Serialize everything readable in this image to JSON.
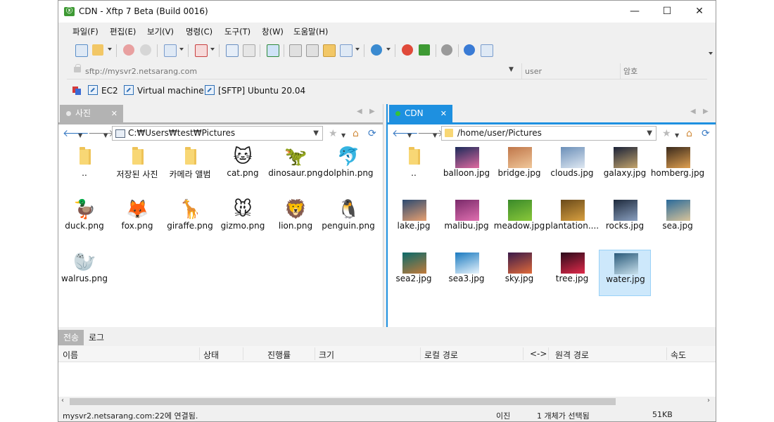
{
  "window": {
    "logo": "Xftp",
    "title": "CDN - Xftp 7 Beta (Build 0016)",
    "controls": {
      "minimize": "—",
      "maximize": "☐",
      "close": "✕"
    }
  },
  "menu": [
    "파일(F)",
    "편집(E)",
    "보기(V)",
    "명령(C)",
    "도구(T)",
    "창(W)",
    "도움말(H)"
  ],
  "address": {
    "placeholder": "sftp://mysvr2.netsarang.com",
    "user_placeholder": "user",
    "password_placeholder": "암호"
  },
  "links": [
    "EC2",
    "Virtual machine",
    "[SFTP] Ubuntu 20.04"
  ],
  "left_pane": {
    "tab": "사진",
    "path": "C:₩Users₩test₩Pictures",
    "files": [
      {
        "name": "..",
        "type": "folder"
      },
      {
        "name": "저장된 사진",
        "type": "folder"
      },
      {
        "name": "카메라 앨범",
        "type": "folder"
      },
      {
        "name": "cat.png",
        "icon": "🐱"
      },
      {
        "name": "dinosaur.png",
        "icon": "🦖"
      },
      {
        "name": "dolphin.png",
        "icon": "🐬"
      },
      {
        "name": "duck.png",
        "icon": "🦆"
      },
      {
        "name": "fox.png",
        "icon": "🦊"
      },
      {
        "name": "giraffe.png",
        "icon": "🦒"
      },
      {
        "name": "gizmo.png",
        "icon": "🐭"
      },
      {
        "name": "lion.png",
        "icon": "🦁"
      },
      {
        "name": "penguin.png",
        "icon": "🐧"
      },
      {
        "name": "walrus.png",
        "icon": "🦭"
      }
    ]
  },
  "right_pane": {
    "tab": "CDN",
    "path": "/home/user/Pictures",
    "files": [
      {
        "name": "..",
        "type": "folder"
      },
      {
        "name": "balloon.jpg",
        "colors": [
          "#1c2b5a",
          "#e06aa0"
        ]
      },
      {
        "name": "bridge.jpg",
        "colors": [
          "#c0774a",
          "#f0c79a"
        ]
      },
      {
        "name": "clouds.jpg",
        "colors": [
          "#6b8fb8",
          "#dfe8f2"
        ]
      },
      {
        "name": "galaxy.jpg",
        "colors": [
          "#1a2238",
          "#c3a46c"
        ]
      },
      {
        "name": "homberg.jpg",
        "colors": [
          "#3a2a1c",
          "#e0a050"
        ]
      },
      {
        "name": "lake.jpg",
        "colors": [
          "#2c4a70",
          "#e8a070"
        ]
      },
      {
        "name": "malibu.jpg",
        "colors": [
          "#7a2a6a",
          "#e070b0"
        ]
      },
      {
        "name": "meadow.jpg",
        "colors": [
          "#3a8a2a",
          "#8ac83a"
        ]
      },
      {
        "name": "plantation....",
        "colors": [
          "#6a4a1a",
          "#d8a040"
        ]
      },
      {
        "name": "rocks.jpg",
        "colors": [
          "#1e2a3c",
          "#8aa0c0"
        ]
      },
      {
        "name": "sea.jpg",
        "colors": [
          "#2a6a9a",
          "#d8c49a"
        ]
      },
      {
        "name": "sea2.jpg",
        "colors": [
          "#0a6a6a",
          "#c07a3a"
        ]
      },
      {
        "name": "sea3.jpg",
        "colors": [
          "#1a7ac0",
          "#e8f4fc"
        ]
      },
      {
        "name": "sky.jpg",
        "colors": [
          "#3a1a4a",
          "#e06a3a"
        ]
      },
      {
        "name": "tree.jpg",
        "colors": [
          "#2a0a1a",
          "#e02a4a"
        ]
      },
      {
        "name": "water.jpg",
        "colors": [
          "#2a5a7a",
          "#c8e0ec"
        ],
        "selected": true
      }
    ]
  },
  "transfer": {
    "tabs": [
      "전송",
      "로그"
    ],
    "columns": [
      "이름",
      "상태",
      "진행률",
      "크기",
      "로컬 경로",
      "<->",
      "원격 경로",
      "속도"
    ]
  },
  "status": {
    "connection": "mysvr2.netsarang.com:22에 연결됨.",
    "mode": "이진",
    "selection": "1 개체가 선택됨",
    "size": "51KB"
  }
}
